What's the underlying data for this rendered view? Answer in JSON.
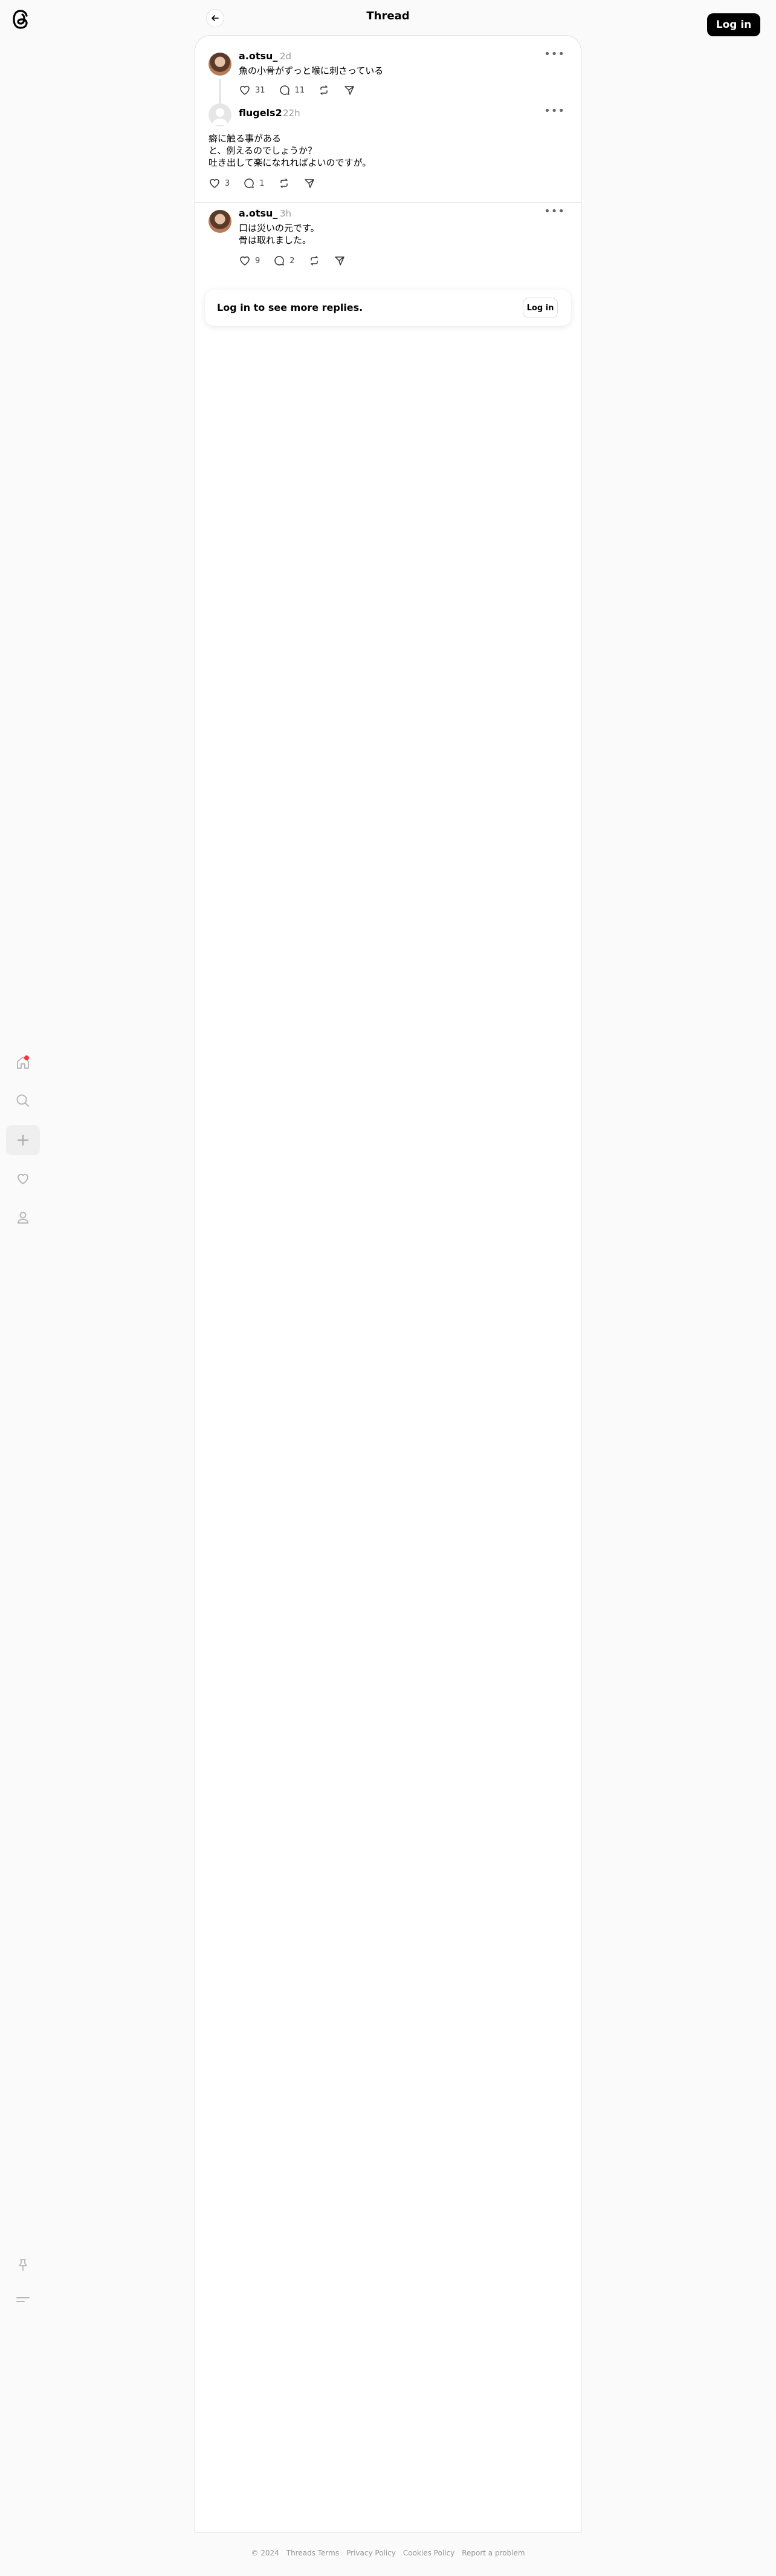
{
  "header": {
    "title": "Thread",
    "login_label": "Log in"
  },
  "sidebar": {
    "items": [
      {
        "icon": "home-icon"
      },
      {
        "icon": "search-icon"
      },
      {
        "icon": "plus-icon"
      },
      {
        "icon": "heart-icon"
      },
      {
        "icon": "profile-icon"
      }
    ],
    "bottom": [
      {
        "icon": "pin-icon"
      },
      {
        "icon": "menu-icon"
      }
    ]
  },
  "posts": [
    {
      "username": "a.otsu_",
      "time": "2d",
      "text": [
        "魚の小骨がずっと喉に刺さっている"
      ],
      "likes": "31",
      "replies": "11"
    },
    {
      "username": "flugels2",
      "time": "22h",
      "text": [
        "癖に触る事がある",
        "と、例えるのでしょうか？",
        "吐き出して楽になれればよいのですが。"
      ],
      "likes": "3",
      "replies": "1"
    },
    {
      "username": "a.otsu_",
      "time": "3h",
      "text": [
        "口は災いの元です。",
        "骨は取れました。"
      ],
      "likes": "9",
      "replies": "2"
    }
  ],
  "login_prompt": {
    "text": "Log in to see more replies.",
    "button": "Log in"
  },
  "footer": {
    "items": [
      "© 2024",
      "Threads Terms",
      "Privacy Policy",
      "Cookies Policy",
      "Report a problem"
    ]
  },
  "colors": {
    "notification": "#ff3040",
    "background": "#fafafa"
  }
}
